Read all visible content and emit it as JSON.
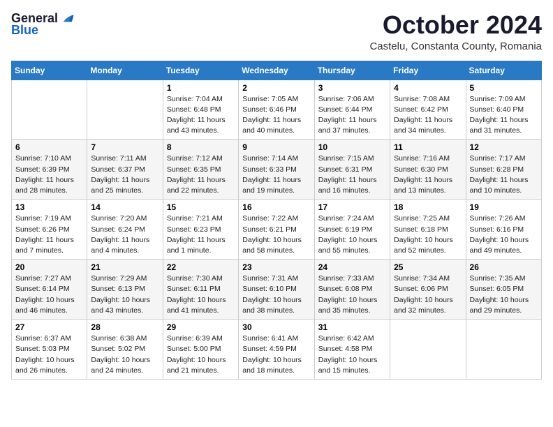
{
  "header": {
    "logo_general": "General",
    "logo_blue": "Blue",
    "month": "October 2024",
    "location": "Castelu, Constanta County, Romania"
  },
  "columns": [
    "Sunday",
    "Monday",
    "Tuesday",
    "Wednesday",
    "Thursday",
    "Friday",
    "Saturday"
  ],
  "weeks": [
    [
      {
        "day": "",
        "detail": ""
      },
      {
        "day": "",
        "detail": ""
      },
      {
        "day": "1",
        "detail": "Sunrise: 7:04 AM\nSunset: 6:48 PM\nDaylight: 11 hours and 43 minutes."
      },
      {
        "day": "2",
        "detail": "Sunrise: 7:05 AM\nSunset: 6:46 PM\nDaylight: 11 hours and 40 minutes."
      },
      {
        "day": "3",
        "detail": "Sunrise: 7:06 AM\nSunset: 6:44 PM\nDaylight: 11 hours and 37 minutes."
      },
      {
        "day": "4",
        "detail": "Sunrise: 7:08 AM\nSunset: 6:42 PM\nDaylight: 11 hours and 34 minutes."
      },
      {
        "day": "5",
        "detail": "Sunrise: 7:09 AM\nSunset: 6:40 PM\nDaylight: 11 hours and 31 minutes."
      }
    ],
    [
      {
        "day": "6",
        "detail": "Sunrise: 7:10 AM\nSunset: 6:39 PM\nDaylight: 11 hours and 28 minutes."
      },
      {
        "day": "7",
        "detail": "Sunrise: 7:11 AM\nSunset: 6:37 PM\nDaylight: 11 hours and 25 minutes."
      },
      {
        "day": "8",
        "detail": "Sunrise: 7:12 AM\nSunset: 6:35 PM\nDaylight: 11 hours and 22 minutes."
      },
      {
        "day": "9",
        "detail": "Sunrise: 7:14 AM\nSunset: 6:33 PM\nDaylight: 11 hours and 19 minutes."
      },
      {
        "day": "10",
        "detail": "Sunrise: 7:15 AM\nSunset: 6:31 PM\nDaylight: 11 hours and 16 minutes."
      },
      {
        "day": "11",
        "detail": "Sunrise: 7:16 AM\nSunset: 6:30 PM\nDaylight: 11 hours and 13 minutes."
      },
      {
        "day": "12",
        "detail": "Sunrise: 7:17 AM\nSunset: 6:28 PM\nDaylight: 11 hours and 10 minutes."
      }
    ],
    [
      {
        "day": "13",
        "detail": "Sunrise: 7:19 AM\nSunset: 6:26 PM\nDaylight: 11 hours and 7 minutes."
      },
      {
        "day": "14",
        "detail": "Sunrise: 7:20 AM\nSunset: 6:24 PM\nDaylight: 11 hours and 4 minutes."
      },
      {
        "day": "15",
        "detail": "Sunrise: 7:21 AM\nSunset: 6:23 PM\nDaylight: 11 hours and 1 minute."
      },
      {
        "day": "16",
        "detail": "Sunrise: 7:22 AM\nSunset: 6:21 PM\nDaylight: 10 hours and 58 minutes."
      },
      {
        "day": "17",
        "detail": "Sunrise: 7:24 AM\nSunset: 6:19 PM\nDaylight: 10 hours and 55 minutes."
      },
      {
        "day": "18",
        "detail": "Sunrise: 7:25 AM\nSunset: 6:18 PM\nDaylight: 10 hours and 52 minutes."
      },
      {
        "day": "19",
        "detail": "Sunrise: 7:26 AM\nSunset: 6:16 PM\nDaylight: 10 hours and 49 minutes."
      }
    ],
    [
      {
        "day": "20",
        "detail": "Sunrise: 7:27 AM\nSunset: 6:14 PM\nDaylight: 10 hours and 46 minutes."
      },
      {
        "day": "21",
        "detail": "Sunrise: 7:29 AM\nSunset: 6:13 PM\nDaylight: 10 hours and 43 minutes."
      },
      {
        "day": "22",
        "detail": "Sunrise: 7:30 AM\nSunset: 6:11 PM\nDaylight: 10 hours and 41 minutes."
      },
      {
        "day": "23",
        "detail": "Sunrise: 7:31 AM\nSunset: 6:10 PM\nDaylight: 10 hours and 38 minutes."
      },
      {
        "day": "24",
        "detail": "Sunrise: 7:33 AM\nSunset: 6:08 PM\nDaylight: 10 hours and 35 minutes."
      },
      {
        "day": "25",
        "detail": "Sunrise: 7:34 AM\nSunset: 6:06 PM\nDaylight: 10 hours and 32 minutes."
      },
      {
        "day": "26",
        "detail": "Sunrise: 7:35 AM\nSunset: 6:05 PM\nDaylight: 10 hours and 29 minutes."
      }
    ],
    [
      {
        "day": "27",
        "detail": "Sunrise: 6:37 AM\nSunset: 5:03 PM\nDaylight: 10 hours and 26 minutes."
      },
      {
        "day": "28",
        "detail": "Sunrise: 6:38 AM\nSunset: 5:02 PM\nDaylight: 10 hours and 24 minutes."
      },
      {
        "day": "29",
        "detail": "Sunrise: 6:39 AM\nSunset: 5:00 PM\nDaylight: 10 hours and 21 minutes."
      },
      {
        "day": "30",
        "detail": "Sunrise: 6:41 AM\nSunset: 4:59 PM\nDaylight: 10 hours and 18 minutes."
      },
      {
        "day": "31",
        "detail": "Sunrise: 6:42 AM\nSunset: 4:58 PM\nDaylight: 10 hours and 15 minutes."
      },
      {
        "day": "",
        "detail": ""
      },
      {
        "day": "",
        "detail": ""
      }
    ]
  ]
}
